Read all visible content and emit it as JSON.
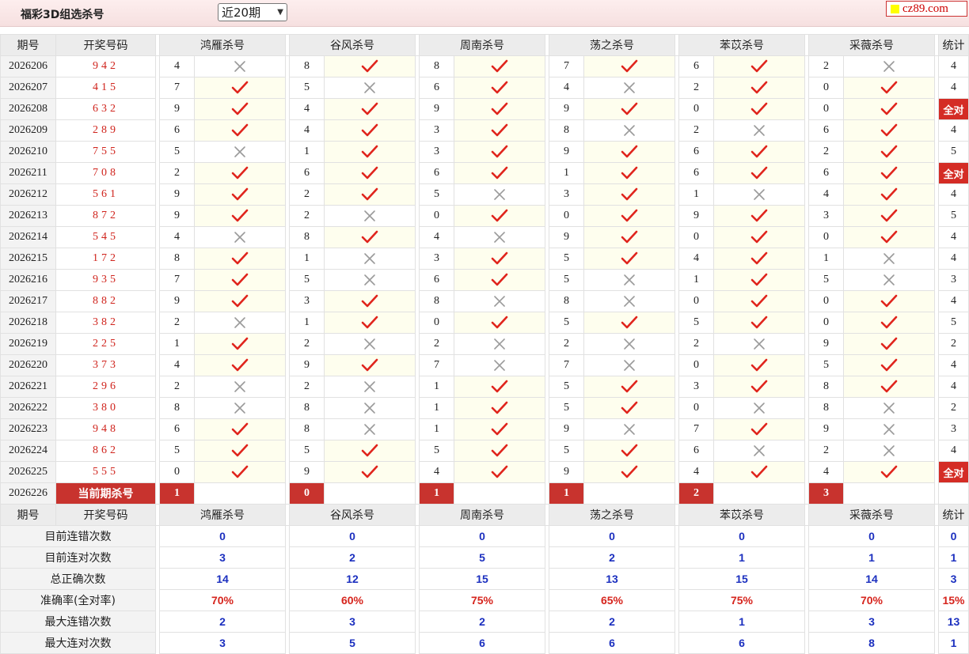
{
  "header": {
    "title": "福彩3D组选杀号",
    "period_select": "近20期",
    "logo_text": "cz89.com"
  },
  "columns": {
    "issue": "期号",
    "draw": "开奖号码",
    "experts": [
      "鸿雁杀号",
      "谷风杀号",
      "周南杀号",
      "荡之杀号",
      "苯苡杀号",
      "采薇杀号"
    ],
    "stat": "统计"
  },
  "rows": [
    {
      "issue": "2026206",
      "draw": "942",
      "picks": [
        {
          "n": "4",
          "ok": false
        },
        {
          "n": "8",
          "ok": true
        },
        {
          "n": "8",
          "ok": true
        },
        {
          "n": "7",
          "ok": true
        },
        {
          "n": "6",
          "ok": true
        },
        {
          "n": "2",
          "ok": false
        }
      ],
      "stat": "4"
    },
    {
      "issue": "2026207",
      "draw": "415",
      "picks": [
        {
          "n": "7",
          "ok": true
        },
        {
          "n": "5",
          "ok": false
        },
        {
          "n": "6",
          "ok": true
        },
        {
          "n": "4",
          "ok": false
        },
        {
          "n": "2",
          "ok": true
        },
        {
          "n": "0",
          "ok": true
        }
      ],
      "stat": "4"
    },
    {
      "issue": "2026208",
      "draw": "632",
      "picks": [
        {
          "n": "9",
          "ok": true
        },
        {
          "n": "4",
          "ok": true
        },
        {
          "n": "9",
          "ok": true
        },
        {
          "n": "9",
          "ok": true
        },
        {
          "n": "0",
          "ok": true
        },
        {
          "n": "0",
          "ok": true
        }
      ],
      "stat": "全对"
    },
    {
      "issue": "2026209",
      "draw": "289",
      "picks": [
        {
          "n": "6",
          "ok": true
        },
        {
          "n": "4",
          "ok": true
        },
        {
          "n": "3",
          "ok": true
        },
        {
          "n": "8",
          "ok": false
        },
        {
          "n": "2",
          "ok": false
        },
        {
          "n": "6",
          "ok": true
        }
      ],
      "stat": "4"
    },
    {
      "issue": "2026210",
      "draw": "755",
      "picks": [
        {
          "n": "5",
          "ok": false
        },
        {
          "n": "1",
          "ok": true
        },
        {
          "n": "3",
          "ok": true
        },
        {
          "n": "9",
          "ok": true
        },
        {
          "n": "6",
          "ok": true
        },
        {
          "n": "2",
          "ok": true
        }
      ],
      "stat": "5"
    },
    {
      "issue": "2026211",
      "draw": "708",
      "picks": [
        {
          "n": "2",
          "ok": true
        },
        {
          "n": "6",
          "ok": true
        },
        {
          "n": "6",
          "ok": true
        },
        {
          "n": "1",
          "ok": true
        },
        {
          "n": "6",
          "ok": true
        },
        {
          "n": "6",
          "ok": true
        }
      ],
      "stat": "全对"
    },
    {
      "issue": "2026212",
      "draw": "561",
      "picks": [
        {
          "n": "9",
          "ok": true
        },
        {
          "n": "2",
          "ok": true
        },
        {
          "n": "5",
          "ok": false
        },
        {
          "n": "3",
          "ok": true
        },
        {
          "n": "1",
          "ok": false
        },
        {
          "n": "4",
          "ok": true
        }
      ],
      "stat": "4"
    },
    {
      "issue": "2026213",
      "draw": "872",
      "picks": [
        {
          "n": "9",
          "ok": true
        },
        {
          "n": "2",
          "ok": false
        },
        {
          "n": "0",
          "ok": true
        },
        {
          "n": "0",
          "ok": true
        },
        {
          "n": "9",
          "ok": true
        },
        {
          "n": "3",
          "ok": true
        }
      ],
      "stat": "5"
    },
    {
      "issue": "2026214",
      "draw": "545",
      "picks": [
        {
          "n": "4",
          "ok": false
        },
        {
          "n": "8",
          "ok": true
        },
        {
          "n": "4",
          "ok": false
        },
        {
          "n": "9",
          "ok": true
        },
        {
          "n": "0",
          "ok": true
        },
        {
          "n": "0",
          "ok": true
        }
      ],
      "stat": "4"
    },
    {
      "issue": "2026215",
      "draw": "172",
      "picks": [
        {
          "n": "8",
          "ok": true
        },
        {
          "n": "1",
          "ok": false
        },
        {
          "n": "3",
          "ok": true
        },
        {
          "n": "5",
          "ok": true
        },
        {
          "n": "4",
          "ok": true
        },
        {
          "n": "1",
          "ok": false
        }
      ],
      "stat": "4"
    },
    {
      "issue": "2026216",
      "draw": "935",
      "picks": [
        {
          "n": "7",
          "ok": true
        },
        {
          "n": "5",
          "ok": false
        },
        {
          "n": "6",
          "ok": true
        },
        {
          "n": "5",
          "ok": false
        },
        {
          "n": "1",
          "ok": true
        },
        {
          "n": "5",
          "ok": false
        }
      ],
      "stat": "3"
    },
    {
      "issue": "2026217",
      "draw": "882",
      "picks": [
        {
          "n": "9",
          "ok": true
        },
        {
          "n": "3",
          "ok": true
        },
        {
          "n": "8",
          "ok": false
        },
        {
          "n": "8",
          "ok": false
        },
        {
          "n": "0",
          "ok": true
        },
        {
          "n": "0",
          "ok": true
        }
      ],
      "stat": "4"
    },
    {
      "issue": "2026218",
      "draw": "382",
      "picks": [
        {
          "n": "2",
          "ok": false
        },
        {
          "n": "1",
          "ok": true
        },
        {
          "n": "0",
          "ok": true
        },
        {
          "n": "5",
          "ok": true
        },
        {
          "n": "5",
          "ok": true
        },
        {
          "n": "0",
          "ok": true
        }
      ],
      "stat": "5"
    },
    {
      "issue": "2026219",
      "draw": "225",
      "picks": [
        {
          "n": "1",
          "ok": true
        },
        {
          "n": "2",
          "ok": false
        },
        {
          "n": "2",
          "ok": false
        },
        {
          "n": "2",
          "ok": false
        },
        {
          "n": "2",
          "ok": false
        },
        {
          "n": "9",
          "ok": true
        }
      ],
      "stat": "2"
    },
    {
      "issue": "2026220",
      "draw": "373",
      "picks": [
        {
          "n": "4",
          "ok": true
        },
        {
          "n": "9",
          "ok": true
        },
        {
          "n": "7",
          "ok": false
        },
        {
          "n": "7",
          "ok": false
        },
        {
          "n": "0",
          "ok": true
        },
        {
          "n": "5",
          "ok": true
        }
      ],
      "stat": "4"
    },
    {
      "issue": "2026221",
      "draw": "296",
      "picks": [
        {
          "n": "2",
          "ok": false
        },
        {
          "n": "2",
          "ok": false
        },
        {
          "n": "1",
          "ok": true
        },
        {
          "n": "5",
          "ok": true
        },
        {
          "n": "3",
          "ok": true
        },
        {
          "n": "8",
          "ok": true
        }
      ],
      "stat": "4"
    },
    {
      "issue": "2026222",
      "draw": "380",
      "picks": [
        {
          "n": "8",
          "ok": false
        },
        {
          "n": "8",
          "ok": false
        },
        {
          "n": "1",
          "ok": true
        },
        {
          "n": "5",
          "ok": true
        },
        {
          "n": "0",
          "ok": false
        },
        {
          "n": "8",
          "ok": false
        }
      ],
      "stat": "2"
    },
    {
      "issue": "2026223",
      "draw": "948",
      "picks": [
        {
          "n": "6",
          "ok": true
        },
        {
          "n": "8",
          "ok": false
        },
        {
          "n": "1",
          "ok": true
        },
        {
          "n": "9",
          "ok": false
        },
        {
          "n": "7",
          "ok": true
        },
        {
          "n": "9",
          "ok": false
        }
      ],
      "stat": "3"
    },
    {
      "issue": "2026224",
      "draw": "862",
      "picks": [
        {
          "n": "5",
          "ok": true
        },
        {
          "n": "5",
          "ok": true
        },
        {
          "n": "5",
          "ok": true
        },
        {
          "n": "5",
          "ok": true
        },
        {
          "n": "6",
          "ok": false
        },
        {
          "n": "2",
          "ok": false
        }
      ],
      "stat": "4"
    },
    {
      "issue": "2026225",
      "draw": "555",
      "picks": [
        {
          "n": "0",
          "ok": true
        },
        {
          "n": "9",
          "ok": true
        },
        {
          "n": "4",
          "ok": true
        },
        {
          "n": "9",
          "ok": true
        },
        {
          "n": "4",
          "ok": true
        },
        {
          "n": "4",
          "ok": true
        }
      ],
      "stat": "全对"
    }
  ],
  "current": {
    "issue": "2026226",
    "label": "当前期杀号",
    "picks": [
      "1",
      "0",
      "1",
      "1",
      "2",
      "3"
    ]
  },
  "summary": [
    {
      "label": "目前连错次数",
      "values": [
        "0",
        "0",
        "0",
        "0",
        "0",
        "0"
      ],
      "stat": "0",
      "red": false
    },
    {
      "label": "目前连对次数",
      "values": [
        "3",
        "2",
        "5",
        "2",
        "1",
        "1"
      ],
      "stat": "1",
      "red": false
    },
    {
      "label": "总正确次数",
      "values": [
        "14",
        "12",
        "15",
        "13",
        "15",
        "14"
      ],
      "stat": "3",
      "red": false
    },
    {
      "label": "准确率(全对率)",
      "values": [
        "70%",
        "60%",
        "75%",
        "65%",
        "75%",
        "70%"
      ],
      "stat": "15%",
      "red": true
    },
    {
      "label": "最大连错次数",
      "values": [
        "2",
        "3",
        "2",
        "2",
        "1",
        "3"
      ],
      "stat": "13",
      "red": false
    },
    {
      "label": "最大连对次数",
      "values": [
        "3",
        "5",
        "6",
        "6",
        "6",
        "8"
      ],
      "stat": "1",
      "red": false
    }
  ],
  "colors": {
    "accent_red": "#d42c25",
    "value_blue": "#1b2fbf",
    "check_red": "#e0241c",
    "cross_gray": "#9a9a9a"
  },
  "icons": {
    "ok": "check-icon",
    "miss": "cross-icon"
  }
}
